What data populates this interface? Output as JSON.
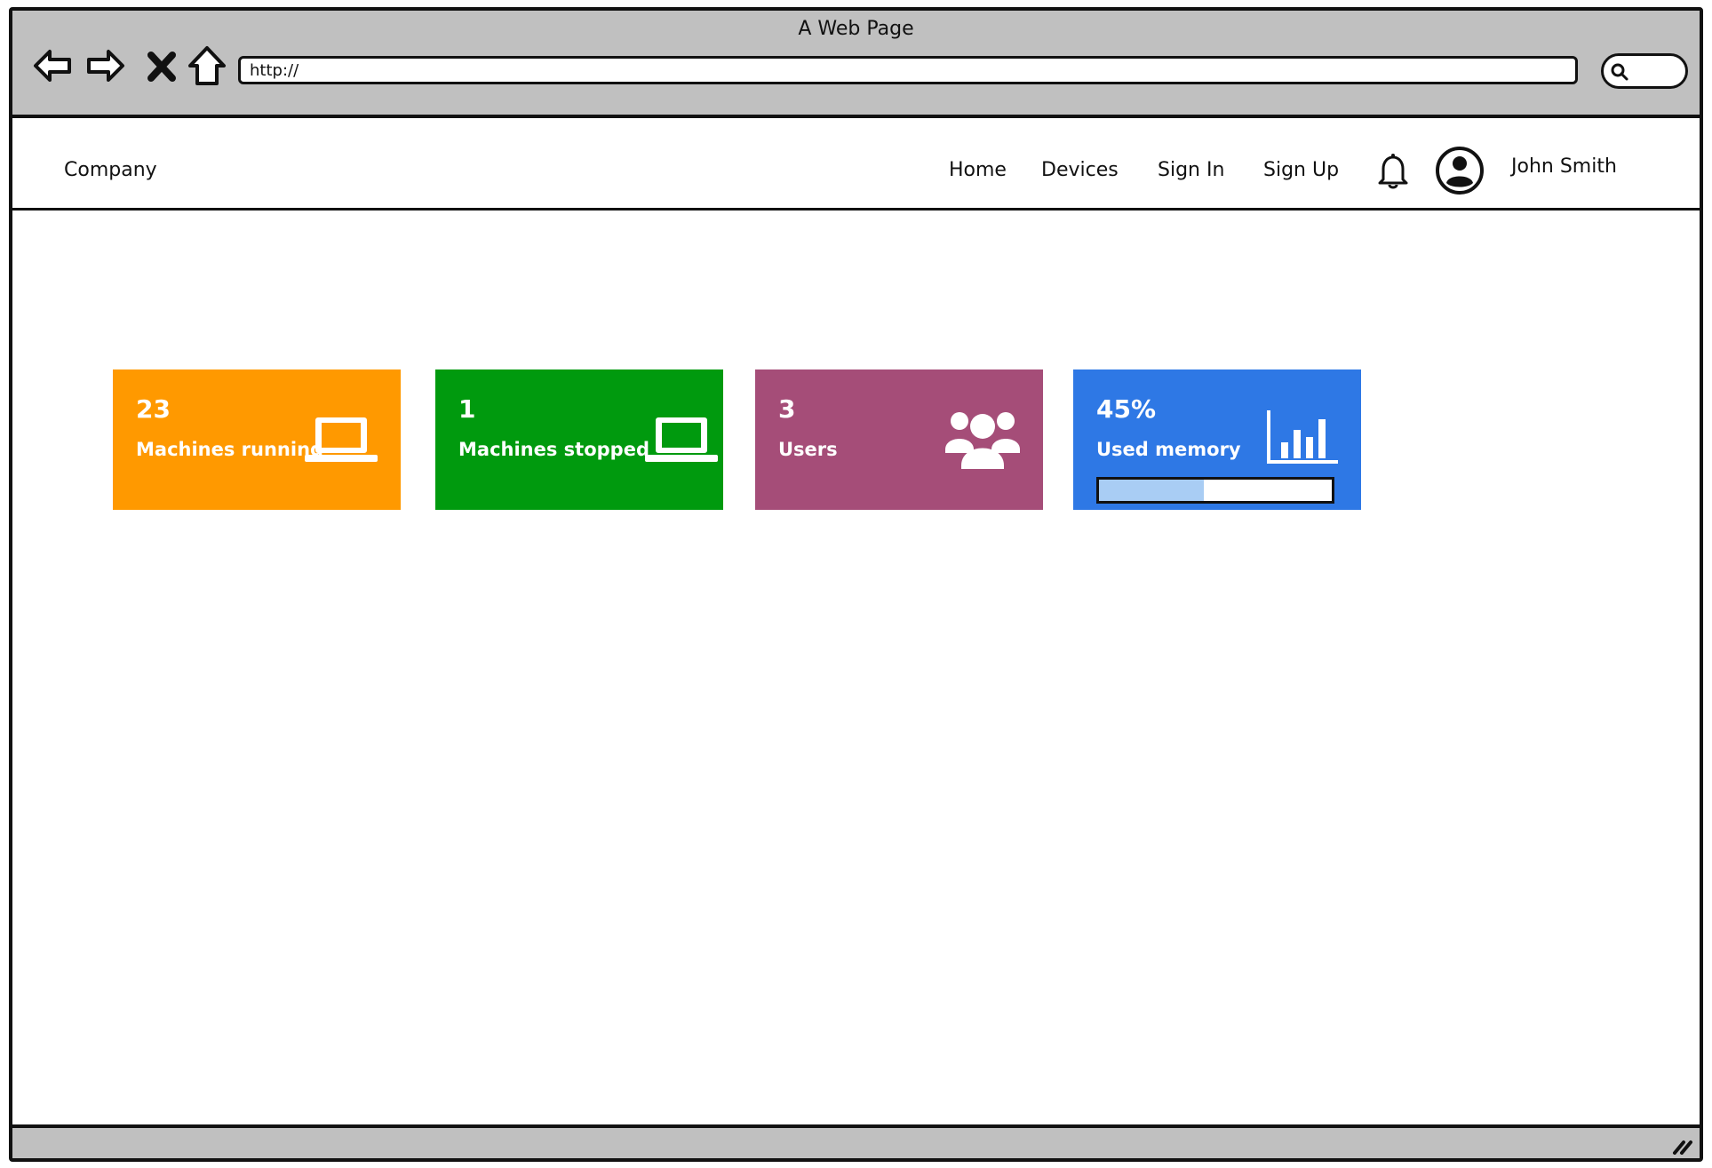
{
  "browser": {
    "title": "A Web Page",
    "url": "http://"
  },
  "header": {
    "brand": "Company",
    "nav": [
      "Home",
      "Devices",
      "Sign In",
      "Sign Up"
    ],
    "user_name": "John Smith",
    "icons": [
      "bell-icon",
      "user-avatar-icon"
    ]
  },
  "cards": [
    {
      "value": "23",
      "label": "Machines running",
      "color": "#ff9900",
      "icon": "laptop-icon"
    },
    {
      "value": "1",
      "label": "Machines stopped",
      "color": "#009a0e",
      "icon": "laptop-icon"
    },
    {
      "value": "3",
      "label": "Users",
      "color": "#a54d78",
      "icon": "users-group-icon"
    },
    {
      "value": "45%",
      "label": "Used memory",
      "color": "#2e78e5",
      "icon": "bar-chart-icon",
      "progress_percent": 45
    }
  ]
}
